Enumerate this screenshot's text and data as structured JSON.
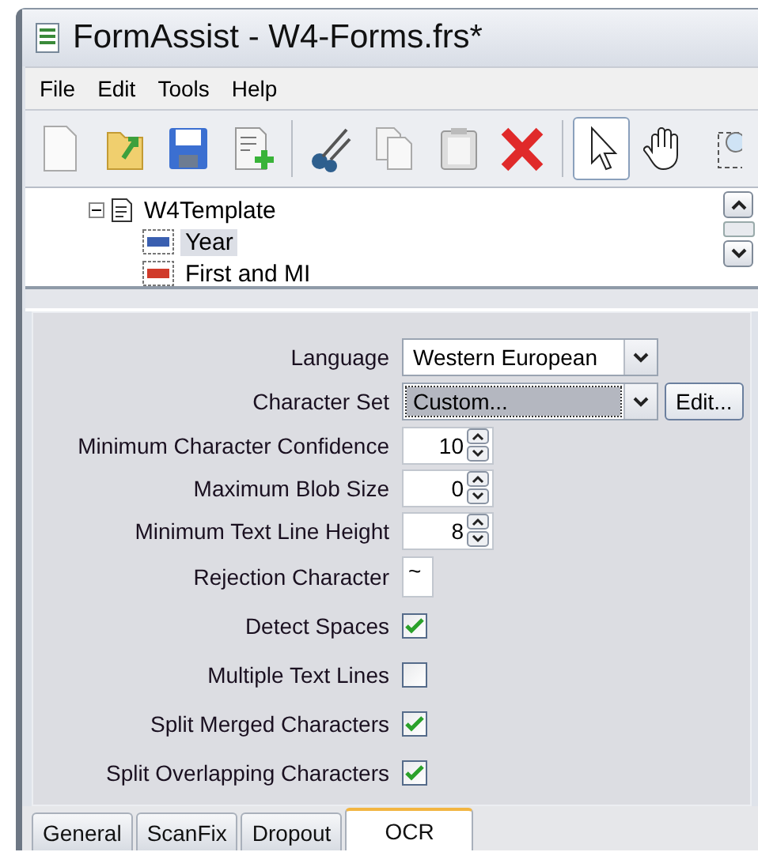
{
  "window": {
    "title": "FormAssist - W4-Forms.frs*"
  },
  "menu": [
    "File",
    "Edit",
    "Tools",
    "Help"
  ],
  "tools": [
    {
      "selected": true
    },
    {
      "selected": false
    },
    {
      "selected": false
    }
  ],
  "tree": {
    "label": "W4Template",
    "expanded": true,
    "children": [
      {
        "label": "Year",
        "selected": true,
        "kind": "blue"
      },
      {
        "label": "First and MI",
        "selected": false,
        "kind": "red"
      }
    ]
  },
  "settings": [
    {
      "kind": "dropdown",
      "label": "Language",
      "value": "Western European",
      "focused": false
    },
    {
      "kind": "dropdown",
      "label": "Character Set",
      "value": "Custom...",
      "focused": true,
      "button": "Edit..."
    },
    {
      "kind": "spinner",
      "label": "Minimum Character Confidence",
      "value": "10"
    },
    {
      "kind": "spinner",
      "label": "Maximum Blob Size",
      "value": "0"
    },
    {
      "kind": "spinner",
      "label": "Minimum Text Line Height",
      "value": "8"
    },
    {
      "kind": "text",
      "label": "Rejection Character",
      "value": "~"
    },
    {
      "kind": "checkbox",
      "label": "Detect Spaces",
      "checked": true
    },
    {
      "kind": "checkbox",
      "label": "Multiple Text Lines",
      "checked": false
    },
    {
      "kind": "checkbox",
      "label": "Split Merged Characters",
      "checked": true
    },
    {
      "kind": "checkbox",
      "label": "Split Overlapping Characters",
      "checked": true
    }
  ],
  "tabs": [
    {
      "label": "General",
      "selected": false
    },
    {
      "label": "ScanFix",
      "selected": false
    },
    {
      "label": "Dropout",
      "selected": false
    },
    {
      "label": "OCR",
      "selected": true
    }
  ]
}
